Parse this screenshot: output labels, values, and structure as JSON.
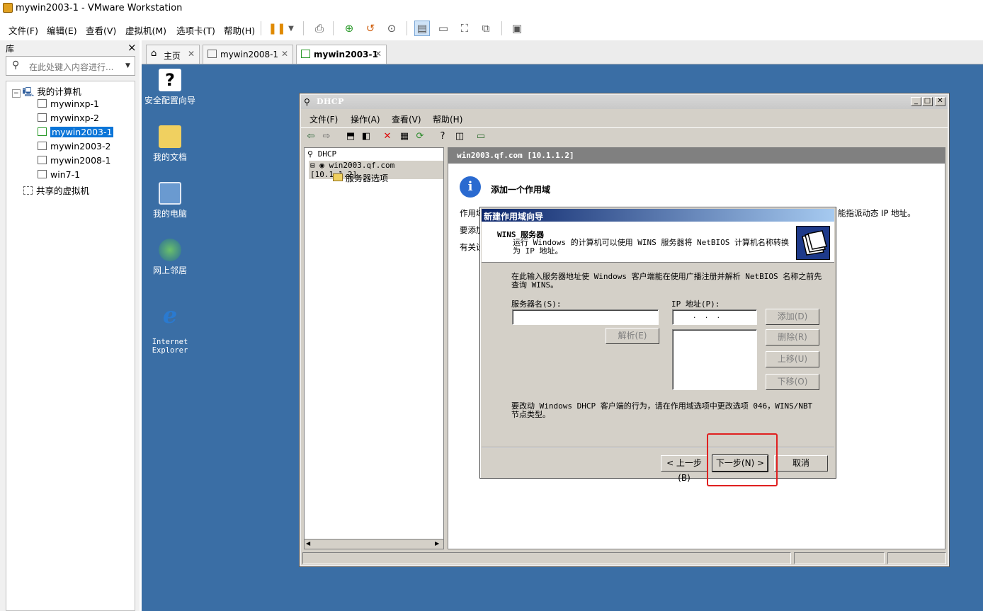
{
  "app": {
    "title": "mywin2003-1 - VMware Workstation"
  },
  "menu": [
    "文件(F)",
    "编辑(E)",
    "查看(V)",
    "虚拟机(M)",
    "选项卡(T)",
    "帮助(H)"
  ],
  "library": {
    "title": "库",
    "close": "×",
    "search_placeholder": "在此处键入内容进行...",
    "tree": {
      "root": "我的计算机",
      "vms": [
        "mywinxp-1",
        "mywinxp-2",
        "mywin2003-1",
        "mywin2003-2",
        "mywin2008-1",
        "win7-1"
      ],
      "selected": "mywin2003-1",
      "shared": "共享的虚拟机"
    }
  },
  "tabs": [
    {
      "label": "主页",
      "active": false
    },
    {
      "label": "mywin2008-1",
      "active": false
    },
    {
      "label": "mywin2003-1",
      "active": true
    }
  ],
  "desktop": {
    "icons": [
      "安全配置向导",
      "我的文档",
      "我的电脑",
      "网上邻居",
      "Internet\nExplorer"
    ]
  },
  "dhcp": {
    "title": "DHCP",
    "menu": [
      "文件(F)",
      "操作(A)",
      "查看(V)",
      "帮助(H)"
    ],
    "tree": {
      "root": "DHCP",
      "server": "win2003.qf.com [10.1.1.2]",
      "child": "服务器选项"
    },
    "pane_header": "win2003.qf.com [10.1.1.2]",
    "info_title": "添加一个作用域",
    "body": [
      "作用域",
      "能指派动态 IP 地址。",
      "要添加",
      "有关设"
    ]
  },
  "wizard": {
    "title": "新建作用域向导",
    "header_title": "WINS 服务器",
    "header_desc": "运行 Windows 的计算机可以使用 WINS 服务器将 NetBIOS 计算机名称转换为 IP 地址。",
    "intro": "在此输入服务器地址使 Windows 客户端能在使用广播注册并解析 NetBIOS 名称之前先查询 WINS。",
    "server_name_label": "服务器名(S):",
    "ip_label": "IP 地址(P):",
    "ip_value": ".   .   .",
    "buttons": {
      "resolve": "解析(E)",
      "add": "添加(D)",
      "remove": "删除(R)",
      "up": "上移(U)",
      "down": "下移(O)",
      "back": "< 上一步(B)",
      "next": "下一步(N) >",
      "cancel": "取消"
    },
    "note": "要改动 Windows DHCP 客户端的行为，请在作用域选项中更改选项 046，WINS/NBT 节点类型。"
  },
  "colors": {
    "desktop": "#3a6ea5",
    "selection": "#0b75d8",
    "highlight_box": "#e02020",
    "wizard_title": "#0a246a"
  }
}
